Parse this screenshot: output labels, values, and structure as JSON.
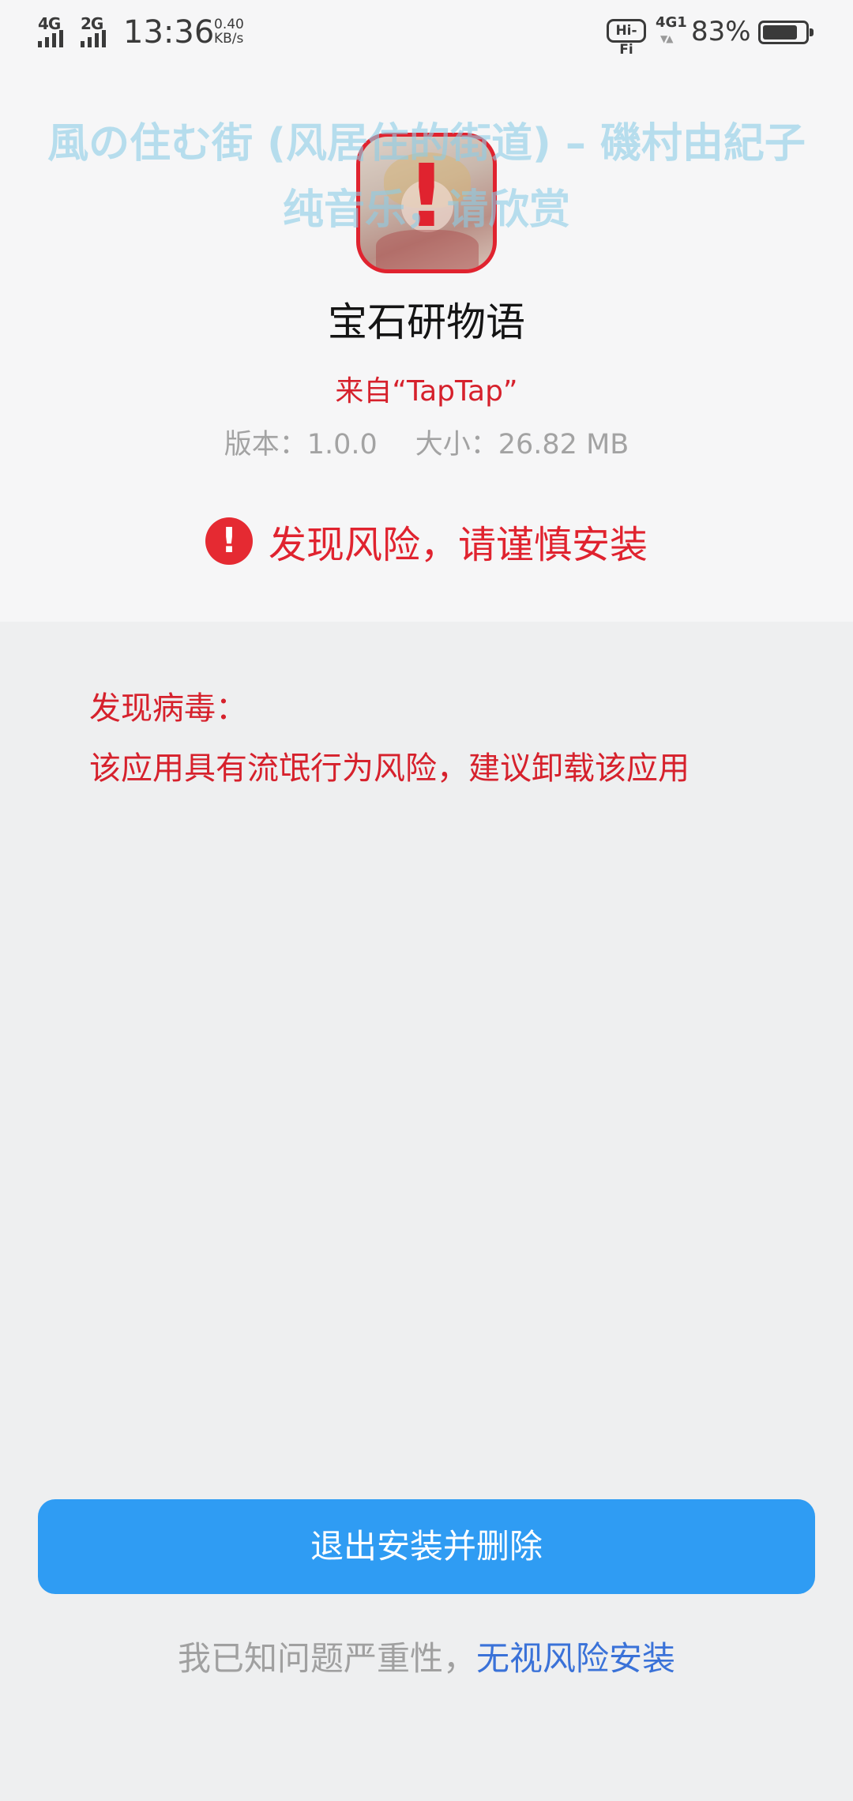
{
  "status_bar": {
    "net1": "4G",
    "net2": "2G",
    "time": "13:36",
    "speed_value": "0.40",
    "speed_unit": "KB/s",
    "hifi": "Hi-Fi",
    "net3": "4G1",
    "battery_percent_text": "83%",
    "battery_level": 0.83
  },
  "overlay_lyric": {
    "line1": "風の住む街 (风居住的街道) – 磯村由紀子",
    "line2": "纯音乐，请欣赏"
  },
  "app": {
    "name": "宝石研物语",
    "source": "来自“TapTap”",
    "version": "版本：1.0.0",
    "size": "大小：26.82 MB",
    "icon": "app-icon-with-warning"
  },
  "risk": {
    "icon_glyph": "!",
    "text": "发现风险，请谨慎安装"
  },
  "virus": {
    "title": "发现病毒：",
    "description": "该应用具有流氓行为风险，建议卸载该应用"
  },
  "actions": {
    "exit_label": "退出安装并删除",
    "ignore_prefix": "我已知问题严重性，",
    "ignore_link": "无视风险安装"
  },
  "colors": {
    "danger": "#e0232f",
    "primary_button": "#2f9cf3",
    "link": "#3a72d8",
    "muted_text": "#a3a3a3"
  }
}
